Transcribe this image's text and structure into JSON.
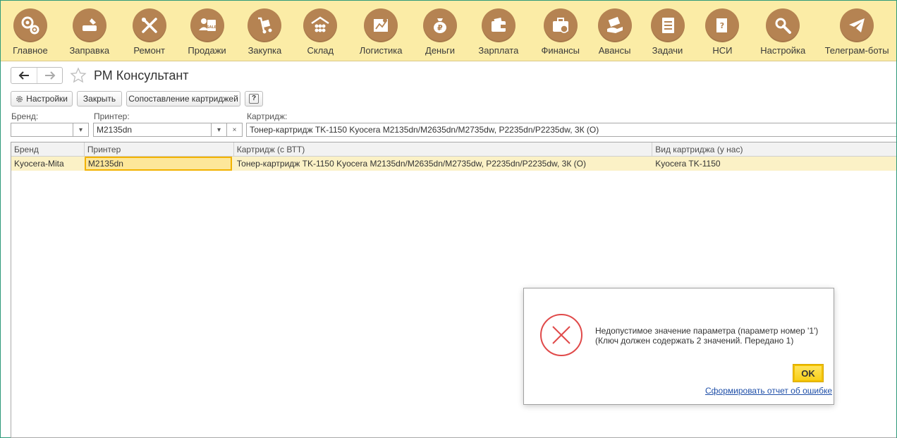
{
  "sections": [
    {
      "label": "Главное",
      "icon": "gears-icon"
    },
    {
      "label": "Заправка",
      "icon": "toner-refill-icon"
    },
    {
      "label": "Ремонт",
      "icon": "tools-icon"
    },
    {
      "label": "Продажи",
      "icon": "sale-icon"
    },
    {
      "label": "Закупка",
      "icon": "hand-truck-icon"
    },
    {
      "label": "Склад",
      "icon": "warehouse-icon"
    },
    {
      "label": "Логистика",
      "icon": "map-route-icon"
    },
    {
      "label": "Деньги",
      "icon": "money-bag-icon"
    },
    {
      "label": "Зарплата",
      "icon": "wallet-icon"
    },
    {
      "label": "Финансы",
      "icon": "briefcase-icon"
    },
    {
      "label": "Авансы",
      "icon": "cash-hand-icon"
    },
    {
      "label": "Задачи",
      "icon": "checklist-icon"
    },
    {
      "label": "НСИ",
      "icon": "reference-book-icon"
    },
    {
      "label": "Настройка",
      "icon": "settings-icon"
    },
    {
      "label": "Телеграм-боты",
      "icon": "telegram-icon"
    }
  ],
  "page": {
    "title": "РМ Консультант"
  },
  "toolbar": {
    "settings_label": "Настройки",
    "close_label": "Закрыть",
    "mapping_label": "Сопоставление картриджей",
    "help_label": "?"
  },
  "filters": {
    "brand_label": "Бренд:",
    "brand_value": "",
    "printer_label": "Принтер:",
    "printer_value": "M2135dn",
    "cartridge_label": "Картридж:",
    "cartridge_value": "Тонер-картридж TK-1150 Kyocera M2135dn/M2635dn/M2735dw, P2235dn/P2235dw, 3К (О)"
  },
  "table": {
    "columns": [
      "Бренд",
      "Принтер",
      "Картридж (с ВТТ)",
      "Вид картриджа (у нас)"
    ],
    "rows": [
      [
        "Kyocera-Mita",
        "M2135dn",
        "Тонер-картридж TK-1150 Kyocera M2135dn/M2635dn/M2735dw, P2235dn/P2235dw, 3К (О)",
        "Kyocera TK-1150"
      ]
    ]
  },
  "dialog": {
    "message": "Недопустимое значение параметра (параметр номер '1') (Ключ должен содержать 2 значений. Передано 1)",
    "ok_label": "OK",
    "report_link": "Сформировать отчет об ошибке"
  },
  "colors": {
    "section_bar": "#fbeca6",
    "section_icon": "#b58352",
    "selected_row": "#fbf1c6",
    "active_cell_border": "#f2b200",
    "error_red": "#e04a4a",
    "ok_button": "#f8d01a"
  }
}
